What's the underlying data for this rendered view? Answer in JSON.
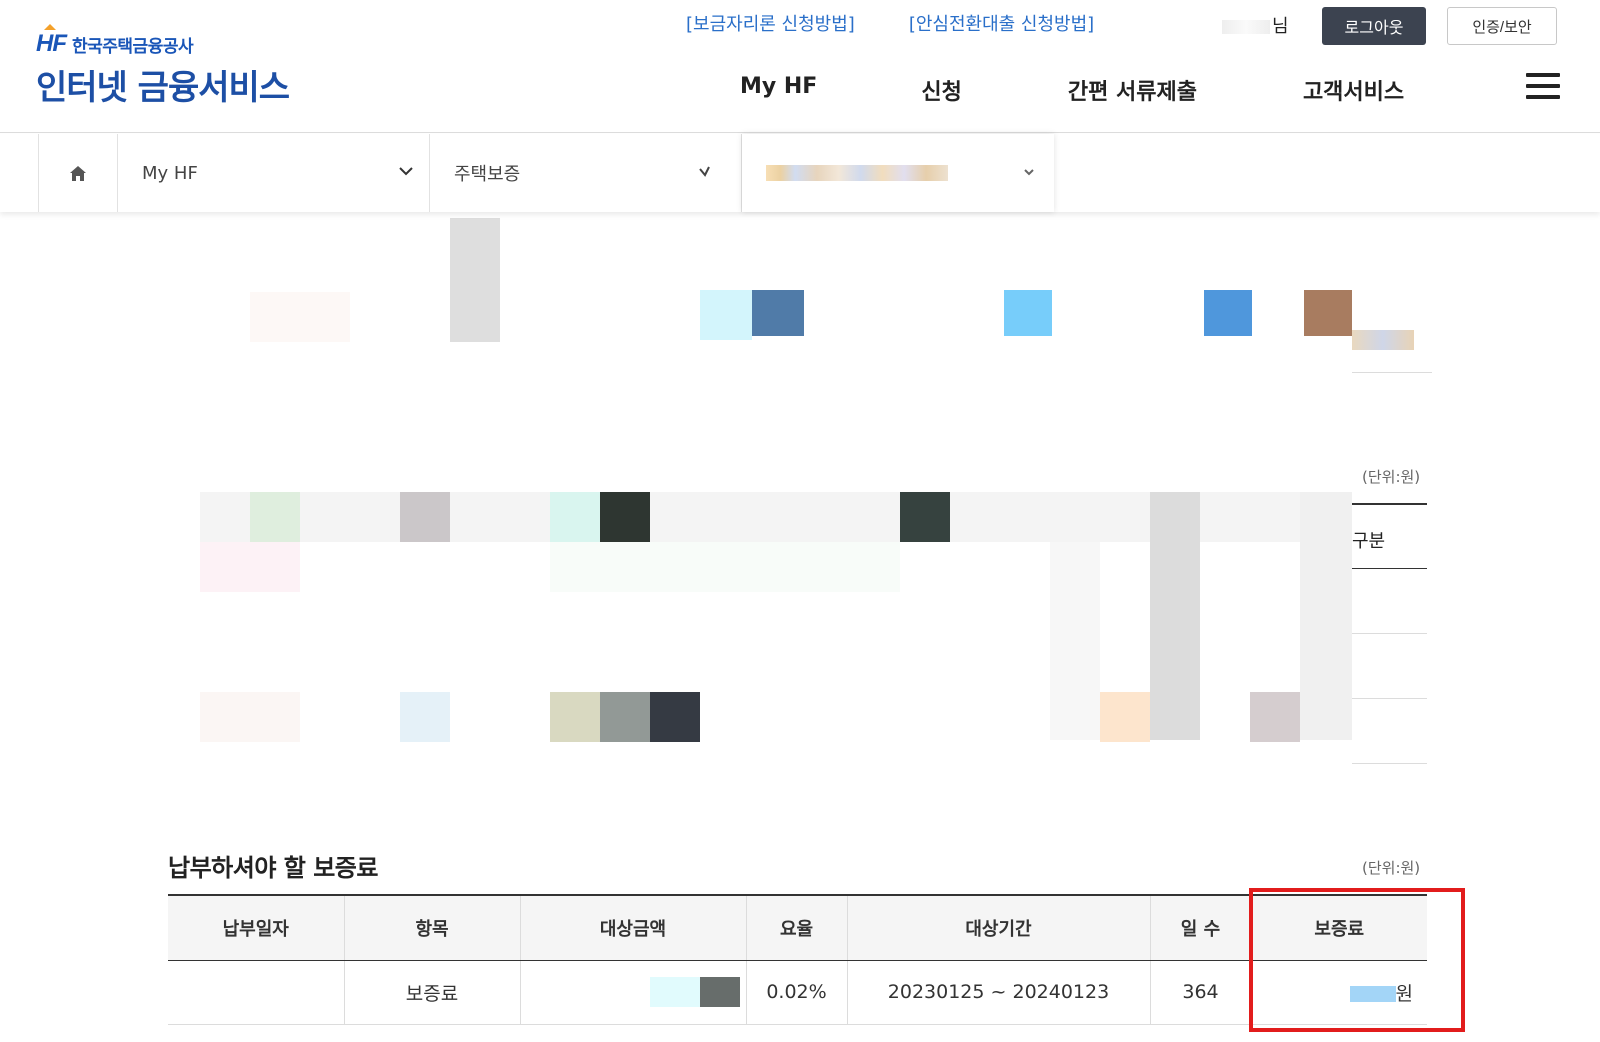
{
  "brand": {
    "mark": "HF",
    "org_name": "한국주택금융공사",
    "service_name": "인터넷 금융서비스"
  },
  "header": {
    "util_links": [
      "[보금자리론 신청방법]",
      "[안심전환대출 신청방법]"
    ],
    "user_suffix": "님",
    "logout_label": "로그아웃",
    "auth_label": "인증/보안",
    "gnb": [
      "My HF",
      "신청",
      "간편 서류제출",
      "고객서비스"
    ]
  },
  "breadcrumb": {
    "level1": "My HF",
    "level2": "주택보증"
  },
  "upper_section": {
    "unit_label": "(단위:원)",
    "column_fragment": "구분"
  },
  "fee_section": {
    "title": "납부하셔야 할 보증료",
    "unit_label": "(단위:원)",
    "columns": [
      "납부일자",
      "항목",
      "대상금액",
      "요율",
      "대상기간",
      "일 수",
      "보증료"
    ],
    "rows": [
      {
        "date": "",
        "item": "보증료",
        "target_amount": "",
        "rate": "0.02%",
        "period": "20230125 ~ 20240123",
        "days": "364",
        "fee_suffix": "원"
      }
    ]
  },
  "colors": {
    "brand_blue": "#1d4fa5",
    "link_blue": "#2a6fc9",
    "logout_bg": "#3c4350",
    "highlight_red": "#e21c1c"
  }
}
